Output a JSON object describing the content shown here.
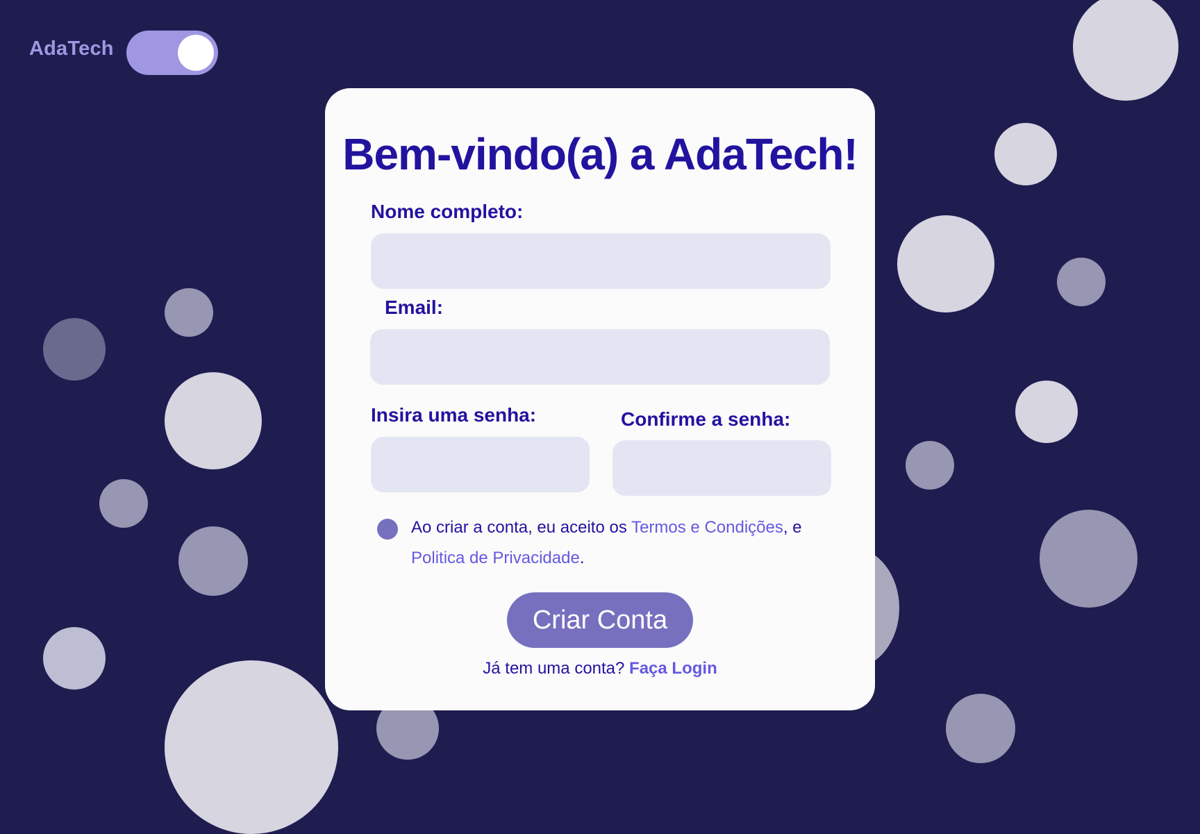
{
  "brand": {
    "name": "AdaTech",
    "toggle_state": "on"
  },
  "form": {
    "title": "Bem-vindo(a) a AdaTech!",
    "full_name_label": "Nome completo:",
    "full_name_value": "",
    "email_label": "Email:",
    "email_value": "",
    "password_label": "Insira uma senha:",
    "password_value": "",
    "confirm_label": "Confirme a senha:",
    "confirm_value": "",
    "terms_prefix": "Ao criar a conta, eu aceito os ",
    "terms_link": "Termos e Condições",
    "terms_middle": ", e ",
    "privacy_link": "Politica de Privacidade",
    "terms_suffix": ".",
    "submit_label": "Criar Conta",
    "login_prompt": "Já tem uma conta? ",
    "login_link": "Faça Login"
  },
  "colors": {
    "background": "#1f1c50",
    "card": "#fbfbfb",
    "primary_text": "#22139f",
    "accent": "#7770bf",
    "link": "#6559e0",
    "toggle": "#9f97e2",
    "field": "#e3e6f2"
  }
}
